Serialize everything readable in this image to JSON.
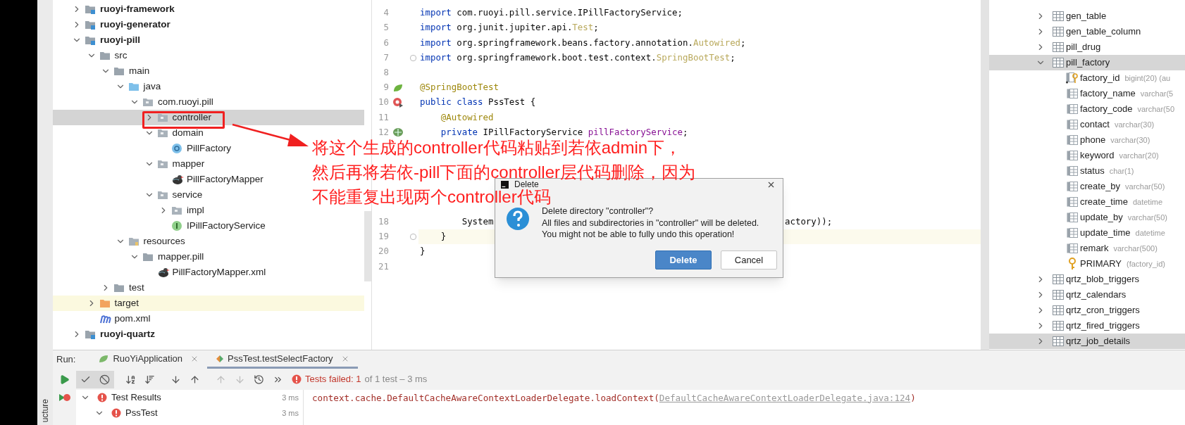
{
  "project_tree": [
    {
      "kind": "module",
      "label": "ruoyi-framework",
      "expanded": false,
      "selected": false
    },
    {
      "kind": "module",
      "label": "ruoyi-generator",
      "expanded": false,
      "selected": false
    },
    {
      "kind": "module",
      "label": "ruoyi-pill",
      "expanded": true,
      "selected": false,
      "children": [
        {
          "kind": "folder",
          "label": "src",
          "expanded": true,
          "selected": false,
          "children": [
            {
              "kind": "folder",
              "label": "main",
              "expanded": true,
              "selected": false,
              "children": [
                {
                  "kind": "source_folder",
                  "label": "java",
                  "expanded": true,
                  "selected": false,
                  "children": [
                    {
                      "kind": "package",
                      "label": "com.ruoyi.pill",
                      "expanded": true,
                      "selected": false,
                      "children": [
                        {
                          "kind": "package",
                          "label": "controller",
                          "expanded": false,
                          "selected": true
                        },
                        {
                          "kind": "package",
                          "label": "domain",
                          "expanded": true,
                          "selected": false,
                          "children": [
                            {
                              "kind": "class",
                              "label": "PillFactory",
                              "selected": false
                            }
                          ]
                        },
                        {
                          "kind": "package",
                          "label": "mapper",
                          "expanded": true,
                          "selected": false,
                          "children": [
                            {
                              "kind": "mybatis",
                              "label": "PillFactoryMapper",
                              "selected": false
                            }
                          ]
                        },
                        {
                          "kind": "package",
                          "label": "service",
                          "expanded": true,
                          "selected": false,
                          "children": [
                            {
                              "kind": "package",
                              "label": "impl",
                              "expanded": false,
                              "selected": false
                            },
                            {
                              "kind": "interface",
                              "label": "IPillFactoryService",
                              "selected": false
                            }
                          ]
                        }
                      ]
                    }
                  ]
                },
                {
                  "kind": "resource_folder",
                  "label": "resources",
                  "expanded": true,
                  "selected": false,
                  "children": [
                    {
                      "kind": "folder",
                      "label": "mapper.pill",
                      "expanded": true,
                      "selected": false,
                      "children": [
                        {
                          "kind": "mybatis",
                          "label": "PillFactoryMapper.xml",
                          "selected": false
                        }
                      ]
                    }
                  ]
                }
              ]
            },
            {
              "kind": "folder",
              "label": "test",
              "expanded": false,
              "selected": false
            }
          ]
        },
        {
          "kind": "excluded_folder",
          "label": "target",
          "expanded": false,
          "selected": false
        },
        {
          "kind": "maven",
          "label": "pom.xml",
          "selected": false
        }
      ]
    },
    {
      "kind": "module",
      "label": "ruoyi-quartz",
      "expanded": false,
      "selected": false
    }
  ],
  "editor": {
    "lines_top": [
      {
        "num": "4",
        "fold": false,
        "current": false,
        "tokens": [
          {
            "kind": "kw",
            "text": "import"
          },
          {
            "kind": "plain",
            "text": " com.ruoyi.pill.service.IPillFactoryService;"
          }
        ]
      },
      {
        "num": "5",
        "fold": false,
        "current": false,
        "tokens": [
          {
            "kind": "kw",
            "text": "import"
          },
          {
            "kind": "plain",
            "text": " org.junit.jupiter.api."
          },
          {
            "kind": "unused",
            "text": "Test"
          },
          {
            "kind": "plain",
            "text": ";"
          }
        ]
      },
      {
        "num": "6",
        "fold": false,
        "current": false,
        "tokens": [
          {
            "kind": "kw",
            "text": "import"
          },
          {
            "kind": "plain",
            "text": " org.springframework.beans.factory.annotation."
          },
          {
            "kind": "unused",
            "text": "Autowired"
          },
          {
            "kind": "plain",
            "text": ";"
          }
        ]
      },
      {
        "num": "7",
        "fold": true,
        "current": false,
        "tokens": [
          {
            "kind": "kw",
            "text": "import"
          },
          {
            "kind": "plain",
            "text": " org.springframework.boot.test.context."
          },
          {
            "kind": "unused",
            "text": "SpringBootTest"
          },
          {
            "kind": "plain",
            "text": ";"
          }
        ]
      },
      {
        "num": "8",
        "fold": false,
        "current": false
      },
      {
        "num": "9",
        "fold": false,
        "current": false,
        "gutter": {
          "kind": "spring"
        },
        "tokens": [
          {
            "kind": "ann",
            "text": "@SpringBootTest"
          }
        ]
      },
      {
        "num": "10",
        "fold": false,
        "current": false,
        "gutter": {
          "kind": "run_error"
        },
        "tokens": [
          {
            "kind": "kw",
            "text": "public class"
          },
          {
            "kind": "plain",
            "text": " PssTest {"
          }
        ]
      },
      {
        "num": "11",
        "fold": false,
        "current": false,
        "tokens": [
          {
            "kind": "ann",
            "text": "    @Autowired"
          }
        ]
      },
      {
        "num": "12",
        "fold": false,
        "current": false,
        "gutter": {
          "kind": "bean"
        },
        "tokens": [
          {
            "kind": "kw",
            "text": "    private"
          },
          {
            "kind": "plain",
            "text": " IPillFactoryService "
          },
          {
            "kind": "field",
            "text": "pillFactoryService"
          },
          {
            "kind": "plain",
            "text": ";"
          }
        ]
      }
    ],
    "lines_bottom": [
      {
        "num": "18",
        "fold": false,
        "current": false,
        "tokens": [
          {
            "kind": "plain",
            "text": "        System"
          }
        ],
        "tail": "actory));"
      },
      {
        "num": "19",
        "fold": true,
        "current": true,
        "tokens": [
          {
            "kind": "plain",
            "text": "    }"
          }
        ]
      },
      {
        "num": "20",
        "fold": false,
        "current": false,
        "tokens": [
          {
            "kind": "plain",
            "text": "}"
          }
        ]
      },
      {
        "num": "21",
        "fold": false,
        "current": false
      }
    ]
  },
  "database": {
    "items": [
      {
        "kind": "table",
        "name": "gen_table",
        "expanded": false,
        "selected": false
      },
      {
        "kind": "table",
        "name": "gen_table_column",
        "expanded": false,
        "selected": false
      },
      {
        "kind": "table",
        "name": "pill_drug",
        "expanded": false,
        "selected": false
      },
      {
        "kind": "table",
        "name": "pill_factory",
        "expanded": true,
        "selected": true,
        "children": [
          {
            "kind": "key_column",
            "name": "factory_id",
            "type": "bigint(20) (au"
          },
          {
            "kind": "column",
            "name": "factory_name",
            "type": "varchar(5"
          },
          {
            "kind": "column",
            "name": "factory_code",
            "type": "varchar(50"
          },
          {
            "kind": "column",
            "name": "contact",
            "type": "varchar(30)"
          },
          {
            "kind": "column",
            "name": "phone",
            "type": "varchar(30)"
          },
          {
            "kind": "column",
            "name": "keyword",
            "type": "varchar(20)"
          },
          {
            "kind": "column",
            "name": "status",
            "type": "char(1)"
          },
          {
            "kind": "column",
            "name": "create_by",
            "type": "varchar(50)"
          },
          {
            "kind": "column",
            "name": "create_time",
            "type": "datetime"
          },
          {
            "kind": "column",
            "name": "update_by",
            "type": "varchar(50)"
          },
          {
            "kind": "column",
            "name": "update_time",
            "type": "datetime"
          },
          {
            "kind": "column",
            "name": "remark",
            "type": "varchar(500)"
          },
          {
            "kind": "key",
            "name": "PRIMARY",
            "type": "(factory_id)"
          }
        ]
      },
      {
        "kind": "table",
        "name": "qrtz_blob_triggers",
        "expanded": false,
        "selected": false
      },
      {
        "kind": "table",
        "name": "qrtz_calendars",
        "expanded": false,
        "selected": false
      },
      {
        "kind": "table",
        "name": "qrtz_cron_triggers",
        "expanded": false,
        "selected": false
      },
      {
        "kind": "table",
        "name": "qrtz_fired_triggers",
        "expanded": false,
        "selected": false
      },
      {
        "kind": "table",
        "name": "qrtz_job_details",
        "expanded": false,
        "selected": true
      }
    ]
  },
  "annotation": {
    "lines": [
      "将这个生成的controller代码粘贴到若依admin下，",
      "然后再将若依-pill下面的controller层代码删除，因为",
      "不能重复出现两个controller代码"
    ]
  },
  "dialog": {
    "title": "Delete",
    "lines": [
      "Delete directory \"controller\"?",
      "All files and subdirectories in \"controller\" will be deleted.",
      "You might not be able to fully undo this operation!"
    ],
    "buttons": [
      {
        "label": "Delete",
        "primary": true
      },
      {
        "label": "Cancel",
        "primary": false
      }
    ]
  },
  "run_panel": {
    "label": "Run:",
    "tabs": [
      {
        "kind": "app",
        "label": "RuoYiApplication",
        "selected": false
      },
      {
        "kind": "test",
        "label": "PssTest.testSelectFactory",
        "selected": true
      }
    ],
    "toolbar": [
      {
        "kind": "show_passed",
        "on": true,
        "disabled": false
      },
      {
        "kind": "show_ignored",
        "on": true,
        "disabled": false
      },
      {
        "kind": "sort_alpha",
        "on": false,
        "disabled": false
      },
      {
        "kind": "sort_duration",
        "on": false,
        "disabled": false
      },
      {
        "kind": "expand_all",
        "on": false,
        "disabled": false
      },
      {
        "kind": "collapse_all",
        "on": false,
        "disabled": false
      },
      {
        "kind": "previous",
        "on": false,
        "disabled": true
      },
      {
        "kind": "next",
        "on": false,
        "disabled": true
      },
      {
        "kind": "history",
        "on": false,
        "disabled": false
      },
      {
        "kind": "more",
        "on": false,
        "disabled": false
      }
    ],
    "status": {
      "failed": "Tests failed: 1",
      "detail": "of 1 test – 3 ms"
    },
    "test_tree": [
      {
        "kind": "failed",
        "label": "Test Results",
        "time": "3 ms",
        "expanded": true,
        "children": [
          {
            "kind": "failed",
            "label": "PssTest",
            "time": "3 ms",
            "expanded": true
          }
        ]
      }
    ],
    "console": {
      "text": "context.cache.DefaultCacheAwareContextLoaderDelegate.loadContext(",
      "link": "DefaultCacheAwareContextLoaderDelegate.java:124",
      "end": ")"
    }
  },
  "side_label": "ucture"
}
